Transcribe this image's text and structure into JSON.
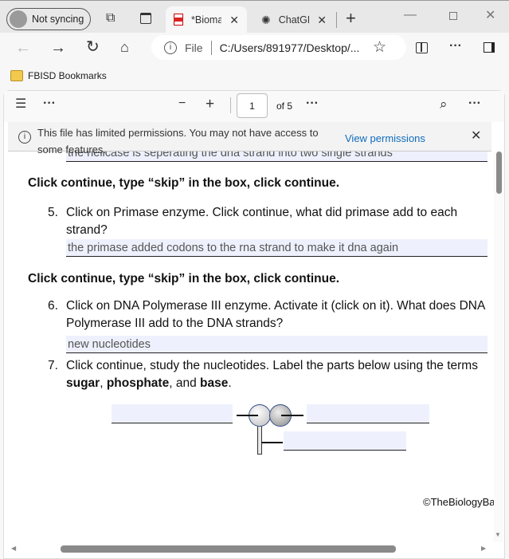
{
  "browser": {
    "profile_label": "Not syncing",
    "tabs": [
      {
        "title": "*Bioman",
        "icon": "pdf-icon",
        "active": true
      },
      {
        "title": "ChatGPT",
        "icon": "chatgpt-icon",
        "active": false
      }
    ],
    "address": {
      "scheme_label": "File",
      "url": "C:/Users/891977/Desktop/..."
    },
    "bookmark": "FBISD Bookmarks"
  },
  "pdf_toolbar": {
    "page_number": "1",
    "page_total": "of 5"
  },
  "notice": {
    "text": "This file has limited permissions. You may not have access to some features.",
    "link": "View permissions"
  },
  "document": {
    "prev_answer": "the helicase is seperating the dna strand into two single strands",
    "instruction1": "Click continue, type “skip” in the box, click continue.",
    "q5_num": "5.",
    "q5": "Click on Primase enzyme. Click continue, what did primase add to each strand?",
    "q5_answer": "the primase added codons to the rna strand to make it dna again",
    "instruction2": "Click continue, type “skip” in the box, click continue.",
    "q6_num": "6.",
    "q6": "Click on DNA Polymerase III enzyme. Activate it (click on it).  What does DNA Polymerase III add to the DNA strands?",
    "q6_answer": "new nucleotides",
    "q7_num": "7.",
    "q7_pre": "Click continue, study the nucleotides.  Label the parts below using the terms ",
    "q7_sugar": "sugar",
    "q7_sep1": ", ",
    "q7_phosphate": "phosphate",
    "q7_sep2": ", and ",
    "q7_base": "base",
    "q7_end": ".",
    "label_left": "",
    "label_right": "",
    "label_bottom": "",
    "copyright": "©TheBiologyBa"
  }
}
